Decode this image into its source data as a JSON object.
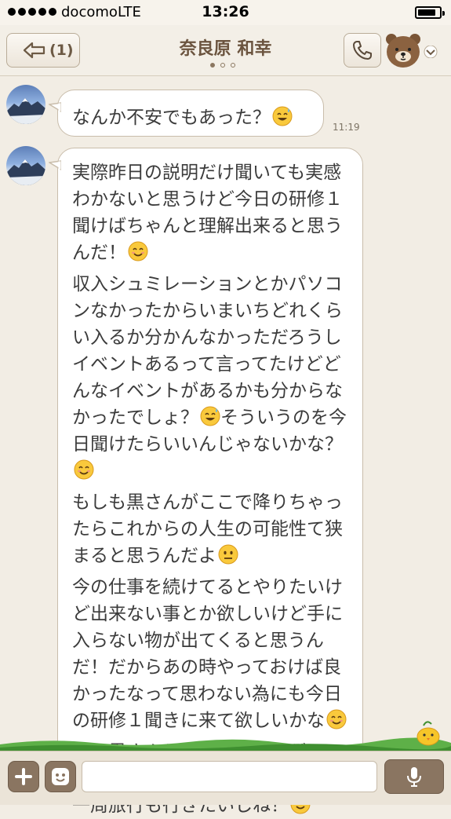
{
  "status_bar": {
    "carrier": "docomo",
    "network": "LTE",
    "time": "13:26",
    "signal_bars": 5,
    "battery_level": 0.85
  },
  "header": {
    "unread_count": "(1)",
    "contact_name": "奈良原 和幸",
    "page_indicator_active": 1,
    "page_indicator_total": 3
  },
  "messages": [
    {
      "text": "なんか不安でもあった？",
      "emoji": "sweat-smile-icon",
      "time": "11:19"
    },
    {
      "paragraphs": [
        {
          "text": "実際昨日の説明だけ聞いても実感わかないと思うけど今日の研修１聞けばちゃんと理解出来ると思うんだ！",
          "emoji": "smile-icon"
        },
        {
          "text": "収入シュミレーションとかパソコンなかったからいまいちどれくらい入るか分かんなかっただろうしイベントあるって言ってたけどどんなイベントがあるかも分からなかったでしょ？",
          "emoji": "sweat-smile-icon",
          "text_after": "そういうのを今日聞けたらいいんじゃないかな？",
          "emoji_after": "smile-icon"
        },
        {
          "text": "もしも黒さんがここで降りちゃったらこれからの人生の可能性て狭まると思うんだよ",
          "emoji": "neutral-face-icon"
        },
        {
          "text": "今の仕事を続けてるとやりたいけど出来ない事とか欲しいけど手に入らない物が出てくると思うんだ！だからあの時やっておけば良かったなって思わない為にも今日の研修１聞きに来て欲しいかな",
          "emoji": "smile-icon"
        },
        {
          "text": "俺は黒さんとプライベートゲレンデでスノボーしたいし一緒に世界一周旅行も行きたいしね！",
          "emoji": "smile-icon"
        }
      ]
    }
  ],
  "input": {
    "value": "",
    "placeholder": ""
  },
  "colors": {
    "background": "#f2ede4",
    "header_text": "#6b543f",
    "button_brown": "#8a7561",
    "bubble_border": "#c9bdab"
  }
}
